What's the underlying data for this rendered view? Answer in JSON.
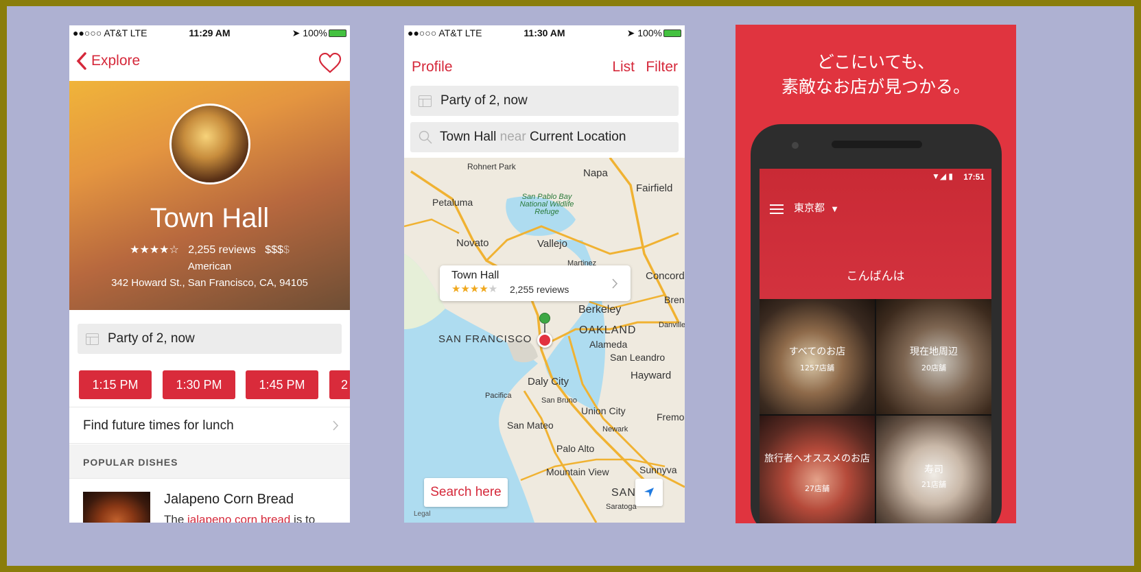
{
  "colors": {
    "outer_border": "#8a7d0a",
    "background": "#aeb1d2",
    "accent_red": "#d5283a",
    "map_water": "#aedcf0",
    "android_red": "#e0343f"
  },
  "phone1": {
    "status": {
      "carrier": "●●○○○ AT&T  LTE",
      "time": "11:29 AM",
      "battery": "100%"
    },
    "nav": {
      "back_label": "Explore",
      "back_icon": "chevron-left-icon",
      "favorite_icon": "heart-icon"
    },
    "restaurant": {
      "name": "Town Hall",
      "stars": "★★★★☆",
      "reviews": "2,255 reviews",
      "price": "$$$",
      "price_dim": "$",
      "cuisine": "American",
      "address": "342 Howard St., San Francisco, CA, 94105"
    },
    "party": "Party of 2, now",
    "times": [
      "1:15 PM",
      "1:30 PM",
      "1:45 PM",
      "2"
    ],
    "future_times": "Find future times for lunch",
    "popular_header": "POPULAR DISHES",
    "dish": {
      "title": "Jalapeno Corn Bread",
      "text_prefix": "The ",
      "text_link": "jalapeno corn bread",
      "text_suffix": " is to"
    }
  },
  "phone2": {
    "status": {
      "carrier": "●●○○○ AT&T  LTE",
      "time": "11:30 AM",
      "battery": "100%"
    },
    "nav": {
      "left": "Profile",
      "list": "List",
      "filter": "Filter"
    },
    "party": "Party of 2, now",
    "search": {
      "term": "Town Hall",
      "near": "near",
      "location": "Current Location"
    },
    "map_labels": {
      "rohnert": "Rohnert Park",
      "napa": "Napa",
      "fairfield": "Fairfield",
      "petaluma": "Petaluma",
      "sanpablo": "San Pablo Bay National Wildlife Refuge",
      "novato": "Novato",
      "vallejo": "Vallejo",
      "martinez": "Martinez",
      "concord": "Concord",
      "berkeley": "Berkeley",
      "bren": "Bren",
      "oakland": "OAKLAND",
      "danville": "Danville",
      "alameda": "Alameda",
      "sanfrancisco": "SAN FRANCISCO",
      "sanleandro": "San Leandro",
      "dalycity": "Daly City",
      "hayward": "Hayward",
      "pacifica": "Pacifica",
      "sanbruno": "San Bruno",
      "unioncity": "Union City",
      "fremont": "Fremo",
      "sanmateo": "San Mateo",
      "newark": "Newark",
      "paloalto": "Palo Alto",
      "mountainview": "Mountain View",
      "sunnyvale": "Sunnyva",
      "sanjose": "SAN",
      "saratoga": "Saratoga",
      "legal": "Legal"
    },
    "callout": {
      "name": "Town Hall",
      "stars": "★★★★",
      "stars_dim": "★",
      "reviews": "2,255 reviews"
    },
    "search_here": "Search here"
  },
  "phone3": {
    "tagline_1": "どこにいても、",
    "tagline_2": "素敵なお店が見つかる。",
    "status_time": "17:51",
    "area": "東京都",
    "greeting": "こんばんは",
    "tiles": [
      {
        "title": "すべてのお店",
        "count": "1257店舗"
      },
      {
        "title": "現在地周辺",
        "count": "20店舗"
      },
      {
        "title": "旅行者へオススメのお店",
        "count": "27店舗"
      },
      {
        "title": "寿司",
        "count": "21店舗"
      }
    ]
  }
}
